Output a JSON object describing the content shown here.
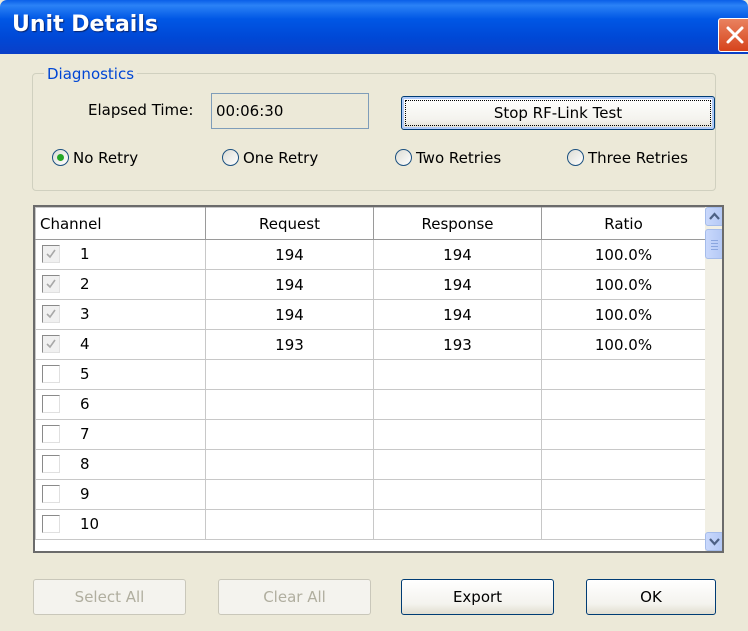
{
  "window": {
    "title": "Unit Details"
  },
  "diagnostics": {
    "group_label": "Diagnostics",
    "elapsed_label": "Elapsed Time:",
    "elapsed_value": "00:06:30",
    "stop_button": "Stop RF-Link Test",
    "retry_options": [
      {
        "label": "No Retry",
        "selected": true
      },
      {
        "label": "One Retry",
        "selected": false
      },
      {
        "label": "Two Retries",
        "selected": false
      },
      {
        "label": "Three Retries",
        "selected": false
      }
    ]
  },
  "grid": {
    "headers": [
      "Channel",
      "Request",
      "Response",
      "Ratio"
    ],
    "rows": [
      {
        "channel": "1",
        "checked": true,
        "request": "194",
        "response": "194",
        "ratio": "100.0%"
      },
      {
        "channel": "2",
        "checked": true,
        "request": "194",
        "response": "194",
        "ratio": "100.0%"
      },
      {
        "channel": "3",
        "checked": true,
        "request": "194",
        "response": "194",
        "ratio": "100.0%"
      },
      {
        "channel": "4",
        "checked": true,
        "request": "193",
        "response": "193",
        "ratio": "100.0%"
      },
      {
        "channel": "5",
        "checked": false,
        "request": "",
        "response": "",
        "ratio": ""
      },
      {
        "channel": "6",
        "checked": false,
        "request": "",
        "response": "",
        "ratio": ""
      },
      {
        "channel": "7",
        "checked": false,
        "request": "",
        "response": "",
        "ratio": ""
      },
      {
        "channel": "8",
        "checked": false,
        "request": "",
        "response": "",
        "ratio": ""
      },
      {
        "channel": "9",
        "checked": false,
        "request": "",
        "response": "",
        "ratio": ""
      },
      {
        "channel": "10",
        "checked": false,
        "request": "",
        "response": "",
        "ratio": ""
      }
    ]
  },
  "buttons": {
    "select_all": "Select All",
    "clear_all": "Clear All",
    "export": "Export",
    "ok": "OK"
  },
  "colors": {
    "titlebar": "#0054e3",
    "group_label": "#0046d5",
    "radio_dot": "#24a624"
  }
}
